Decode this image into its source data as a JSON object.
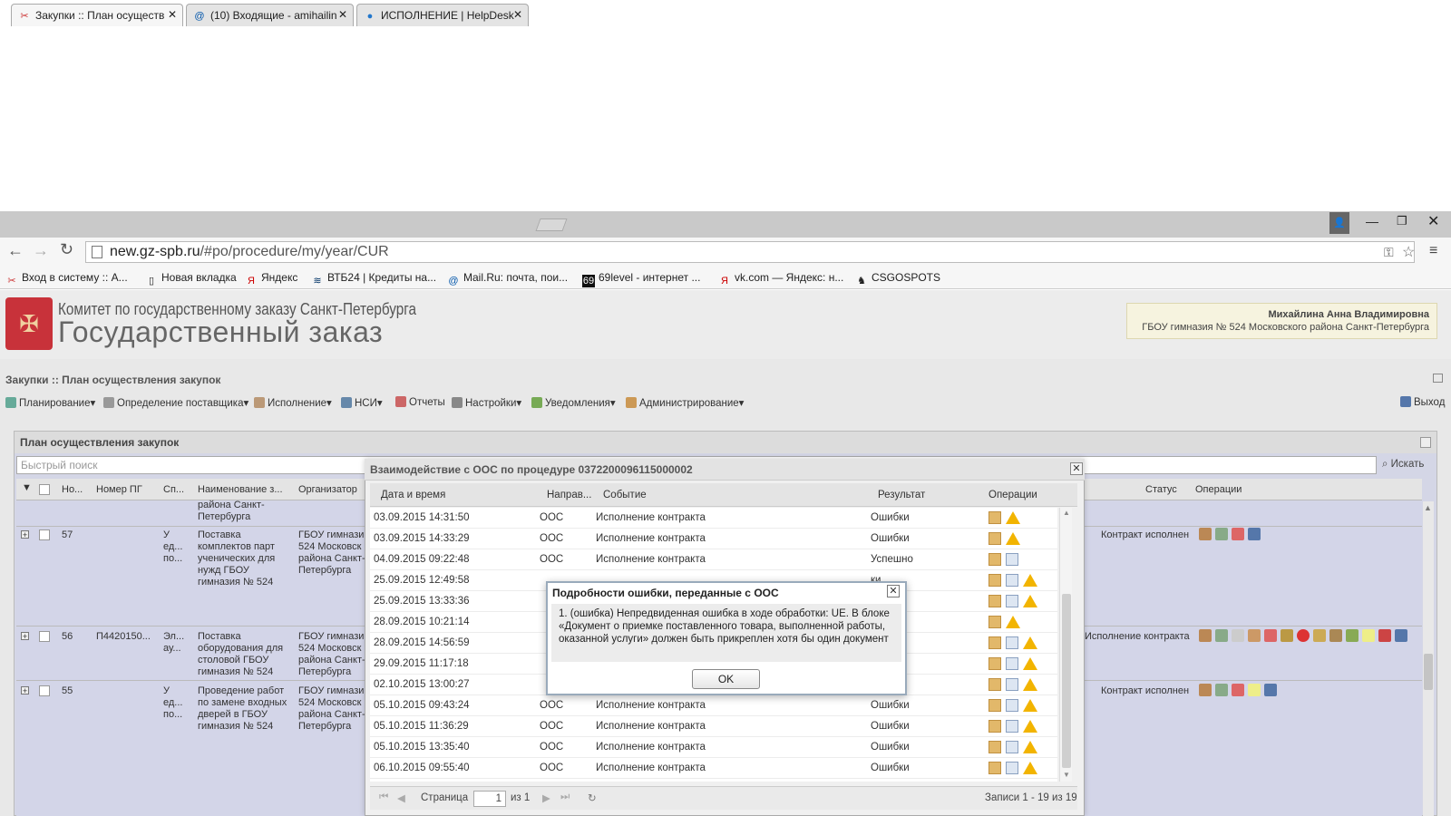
{
  "browser": {
    "tabs": [
      {
        "label": "Закупки :: План осуществ",
        "active": true
      },
      {
        "label": "(10) Входящие - amihailin",
        "active": false
      },
      {
        "label": "ИСПОЛНЕНИЕ | HelpDesk",
        "active": false
      }
    ],
    "url_host": "new.gz-spb.ru",
    "url_path": "/#po/procedure/my/year/CUR",
    "bookmarks": [
      "Вход в систему :: А...",
      "Новая вкладка",
      "Яндекс",
      "ВТБ24 | Кредиты на...",
      "Mail.Ru: почта, пои...",
      "69level - интернет ...",
      "vk.com — Яндекс: н...",
      "CSGOSPOTS"
    ]
  },
  "header": {
    "org_line": "Комитет по государственному заказу Санкт-Петербурга",
    "app_title": "Государственный заказ",
    "user_name": "Михайлина Анна Владимировна",
    "user_org": "ГБОУ гимназия № 524 Московского района Санкт-Петербурга"
  },
  "panel_title": "Закупки :: План осуществления закупок",
  "menu": {
    "items": [
      "Планирование",
      "Определение поставщика",
      "Исполнение",
      "НСИ",
      "Отчеты",
      "Настройки",
      "Уведомления",
      "Администрирование"
    ],
    "exit": "Выход"
  },
  "main": {
    "title": "План осуществления закупок",
    "search_placeholder": "Быстрый поиск",
    "search_button": "Искать",
    "columns": [
      "Но...",
      "Номер ПГ",
      "Сп...",
      "Наименование з...",
      "Организатор",
      "Статус",
      "Операции"
    ],
    "partial_row_text": [
      "района Санкт-",
      "Петербурга"
    ],
    "rows": [
      {
        "num": "57",
        "pg": "",
        "method": [
          "У",
          "ед...",
          "по..."
        ],
        "name": [
          "Поставка",
          "комплектов парт",
          "ученических для",
          "нужд ГБОУ",
          "гимназия № 524"
        ],
        "org": [
          "ГБОУ гимнази",
          "524 Московск",
          "района Санкт-",
          "Петербурга"
        ],
        "status": "Контракт исполнен"
      },
      {
        "num": "56",
        "pg": "П4420150...",
        "method": [
          "Эл...",
          "ау..."
        ],
        "name": [
          "Поставка",
          "оборудования для",
          "столовой ГБОУ",
          "гимназия № 524"
        ],
        "org": [
          "ГБОУ гимнази",
          "524 Московск",
          "района Санкт-",
          "Петербурга"
        ],
        "status": "Исполнение контракта"
      },
      {
        "num": "55",
        "pg": "",
        "method": [
          "У",
          "ед...",
          "по..."
        ],
        "name": [
          "Проведение работ",
          "по замене входных",
          "дверей в ГБОУ",
          "гимназия № 524"
        ],
        "org": [
          "ГБОУ гимнази",
          "524 Московск",
          "района Санкт-",
          "Петербурга"
        ],
        "status": "Контракт исполнен"
      }
    ]
  },
  "dialog": {
    "title": "Взаимодействие с ООС по процедуре 0372200096115000002",
    "columns": [
      "Дата и время",
      "Направ...",
      "Событие",
      "Результат",
      "Операции"
    ],
    "rows": [
      {
        "dt": "03.09.2015 14:31:50",
        "dir": "ООС",
        "event": "Исполнение контракта",
        "result": "Ошибки",
        "icons": [
          "box",
          "warn"
        ]
      },
      {
        "dt": "03.09.2015 14:33:29",
        "dir": "ООС",
        "event": "Исполнение контракта",
        "result": "Ошибки",
        "icons": [
          "box",
          "warn"
        ]
      },
      {
        "dt": "04.09.2015 09:22:48",
        "dir": "ООС",
        "event": "Исполнение контракта",
        "result": "Успешно",
        "icons": [
          "box",
          "doc"
        ]
      },
      {
        "dt": "25.09.2015 12:49:58",
        "dir": "",
        "event": "",
        "result": "ки",
        "icons": [
          "box",
          "doc",
          "warn"
        ]
      },
      {
        "dt": "25.09.2015 13:33:36",
        "dir": "",
        "event": "",
        "result": "ки",
        "icons": [
          "box",
          "doc",
          "warn"
        ]
      },
      {
        "dt": "28.09.2015 10:21:14",
        "dir": "",
        "event": "",
        "result": "ки",
        "icons": [
          "box",
          "warn"
        ]
      },
      {
        "dt": "28.09.2015 14:56:59",
        "dir": "",
        "event": "",
        "result": "ки",
        "icons": [
          "box",
          "doc",
          "warn"
        ]
      },
      {
        "dt": "29.09.2015 11:17:18",
        "dir": "",
        "event": "",
        "result": "ки",
        "icons": [
          "box",
          "doc",
          "warn"
        ]
      },
      {
        "dt": "02.10.2015 13:00:27",
        "dir": "",
        "event": "",
        "result": "ки",
        "icons": [
          "box",
          "doc",
          "warn"
        ]
      },
      {
        "dt": "05.10.2015 09:43:24",
        "dir": "ООС",
        "event": "Исполнение контракта",
        "result": "Ошибки",
        "icons": [
          "box",
          "doc",
          "warn"
        ]
      },
      {
        "dt": "05.10.2015 11:36:29",
        "dir": "ООС",
        "event": "Исполнение контракта",
        "result": "Ошибки",
        "icons": [
          "box",
          "doc",
          "warn"
        ]
      },
      {
        "dt": "05.10.2015 13:35:40",
        "dir": "ООС",
        "event": "Исполнение контракта",
        "result": "Ошибки",
        "icons": [
          "box",
          "doc",
          "warn"
        ]
      },
      {
        "dt": "06.10.2015 09:55:40",
        "dir": "ООС",
        "event": "Исполнение контракта",
        "result": "Ошибки",
        "icons": [
          "box",
          "doc",
          "warn"
        ]
      }
    ],
    "pager": {
      "page_label": "Страница",
      "page": "1",
      "of_label": "из 1",
      "records": "Записи 1 - 19 из 19"
    }
  },
  "error_modal": {
    "title": "Подробности ошибки, переданные с ООС",
    "message": "1. (ошибка) Непредвиденная ошибка в ходе обработки: UE. В блоке «Документ о приемке поставленного товара, выполненной работы, оказанной услуги» должен быть прикреплен хотя бы один документ",
    "ok": "OK"
  }
}
